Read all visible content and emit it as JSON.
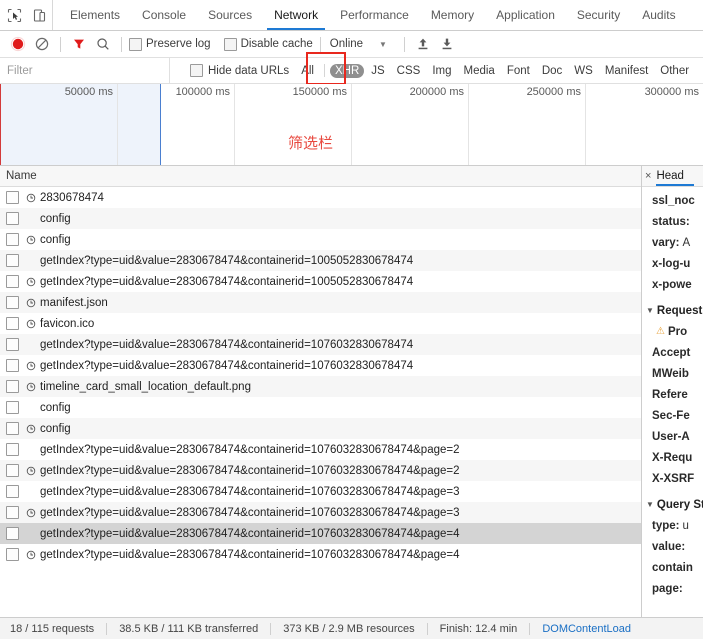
{
  "devtools": {
    "tools": [
      {
        "name": "inspect-element-icon",
        "label": "Inspect element"
      },
      {
        "name": "device-toolbar-icon",
        "label": "Toggle device toolbar"
      }
    ],
    "tabs": [
      {
        "label": "Elements",
        "active": false
      },
      {
        "label": "Console",
        "active": false
      },
      {
        "label": "Sources",
        "active": false
      },
      {
        "label": "Network",
        "active": true
      },
      {
        "label": "Performance",
        "active": false
      },
      {
        "label": "Memory",
        "active": false
      },
      {
        "label": "Application",
        "active": false
      },
      {
        "label": "Security",
        "active": false
      },
      {
        "label": "Audits",
        "active": false
      }
    ]
  },
  "toolbar": {
    "record_label": "Record",
    "clear_label": "Clear",
    "filter_label": "Filter",
    "search_label": "Search",
    "preserve_log_label": "Preserve log",
    "disable_cache_label": "Disable cache",
    "throttle_value": "Online",
    "import_har_label": "Import HAR",
    "export_har_label": "Export HAR",
    "accent_blue": "#1e7ad4",
    "record_red": "#e01b1b"
  },
  "filterbar": {
    "placeholder": "Filter",
    "value": "",
    "hide_data_urls_label": "Hide data URLs",
    "types": [
      {
        "label": "All",
        "active": false
      },
      {
        "label": "XHR",
        "active": true
      },
      {
        "label": "JS",
        "active": false
      },
      {
        "label": "CSS",
        "active": false
      },
      {
        "label": "Img",
        "active": false
      },
      {
        "label": "Media",
        "active": false
      },
      {
        "label": "Font",
        "active": false
      },
      {
        "label": "Doc",
        "active": false
      },
      {
        "label": "WS",
        "active": false
      },
      {
        "label": "Manifest",
        "active": false
      },
      {
        "label": "Other",
        "active": false
      }
    ],
    "highlight_color": "#e8281e"
  },
  "overview": {
    "ticks": [
      "50000 ms",
      "100000 ms",
      "150000 ms",
      "200000 ms",
      "250000 ms",
      "300000 ms"
    ],
    "annotation": "筛选栏",
    "annotation_color": "#e8493f",
    "dom_marker_color": "#4a7fd0",
    "load_marker_color": "#d33a3a"
  },
  "requests": {
    "column_header": "Name",
    "selected_index": 16,
    "rows": [
      {
        "name": "2830678474",
        "icon": true
      },
      {
        "name": "config",
        "icon": false
      },
      {
        "name": "config",
        "icon": true
      },
      {
        "name": "getIndex?type=uid&value=2830678474&containerid=1005052830678474",
        "icon": false
      },
      {
        "name": "getIndex?type=uid&value=2830678474&containerid=1005052830678474",
        "icon": true
      },
      {
        "name": "manifest.json",
        "icon": true
      },
      {
        "name": "favicon.ico",
        "icon": true
      },
      {
        "name": "getIndex?type=uid&value=2830678474&containerid=1076032830678474",
        "icon": false
      },
      {
        "name": "getIndex?type=uid&value=2830678474&containerid=1076032830678474",
        "icon": true
      },
      {
        "name": "timeline_card_small_location_default.png",
        "icon": true
      },
      {
        "name": "config",
        "icon": false
      },
      {
        "name": "config",
        "icon": true
      },
      {
        "name": "getIndex?type=uid&value=2830678474&containerid=1076032830678474&page=2",
        "icon": false
      },
      {
        "name": "getIndex?type=uid&value=2830678474&containerid=1076032830678474&page=2",
        "icon": true
      },
      {
        "name": "getIndex?type=uid&value=2830678474&containerid=1076032830678474&page=3",
        "icon": false
      },
      {
        "name": "getIndex?type=uid&value=2830678474&containerid=1076032830678474&page=3",
        "icon": true
      },
      {
        "name": "getIndex?type=uid&value=2830678474&containerid=1076032830678474&page=4",
        "icon": false
      },
      {
        "name": "getIndex?type=uid&value=2830678474&containerid=1076032830678474&page=4",
        "icon": true
      }
    ]
  },
  "detail": {
    "close_label": "×",
    "tabs": [
      {
        "label": "Head",
        "active": true
      }
    ],
    "response_headers": [
      {
        "key": "ssl_noc",
        "value": ""
      },
      {
        "key": "status:",
        "value": ""
      },
      {
        "key": "vary:",
        "value": "A"
      },
      {
        "key": "x-log-u",
        "value": ""
      },
      {
        "key": "x-powe",
        "value": ""
      }
    ],
    "request_section": "Request",
    "request_headers": [
      {
        "key": "Pro",
        "value": "",
        "warn": true
      },
      {
        "key": "Accept",
        "value": "",
        "warn": false
      },
      {
        "key": "MWeib",
        "value": "",
        "warn": false
      },
      {
        "key": "Refere",
        "value": "",
        "warn": false
      },
      {
        "key": "Sec-Fe",
        "value": "",
        "warn": false
      },
      {
        "key": "User-A",
        "value": "",
        "warn": false
      },
      {
        "key": "X-Requ",
        "value": "",
        "warn": false
      },
      {
        "key": "X-XSRF",
        "value": "",
        "warn": false
      }
    ],
    "query_section": "Query St",
    "query_params": [
      {
        "key": "type:",
        "value": "u"
      },
      {
        "key": "value:",
        "value": ""
      },
      {
        "key": "contain",
        "value": ""
      },
      {
        "key": "page:",
        "value": ""
      }
    ]
  },
  "statusbar": {
    "requests": "18 / 115 requests",
    "transferred": "38.5 KB / 111 KB transferred",
    "resources": "373 KB / 2.9 MB resources",
    "finish": "Finish: 12.4 min",
    "domcontentloaded": "DOMContentLoad"
  }
}
